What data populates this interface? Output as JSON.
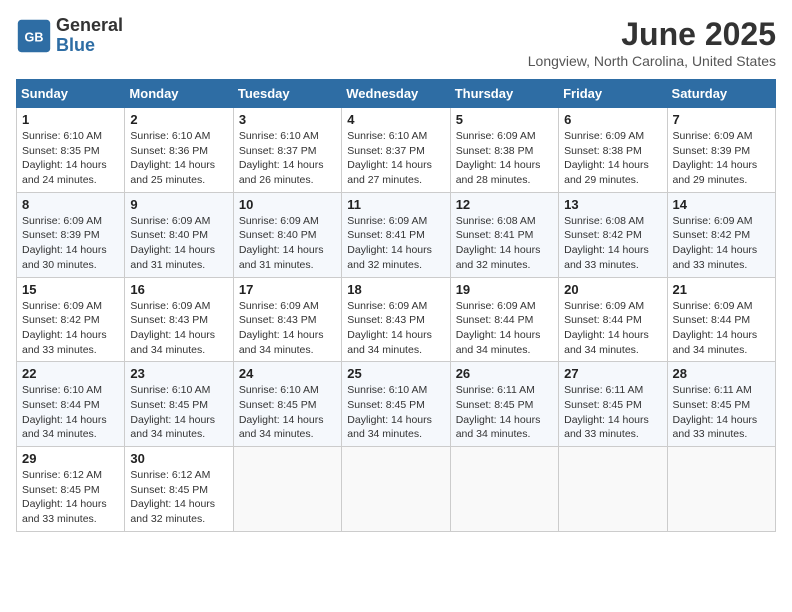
{
  "logo": {
    "general": "General",
    "blue": "Blue"
  },
  "title": "June 2025",
  "location": "Longview, North Carolina, United States",
  "weekdays": [
    "Sunday",
    "Monday",
    "Tuesday",
    "Wednesday",
    "Thursday",
    "Friday",
    "Saturday"
  ],
  "weeks": [
    [
      {
        "day": "1",
        "sunrise": "6:10 AM",
        "sunset": "8:35 PM",
        "daylight": "14 hours and 24 minutes."
      },
      {
        "day": "2",
        "sunrise": "6:10 AM",
        "sunset": "8:36 PM",
        "daylight": "14 hours and 25 minutes."
      },
      {
        "day": "3",
        "sunrise": "6:10 AM",
        "sunset": "8:37 PM",
        "daylight": "14 hours and 26 minutes."
      },
      {
        "day": "4",
        "sunrise": "6:10 AM",
        "sunset": "8:37 PM",
        "daylight": "14 hours and 27 minutes."
      },
      {
        "day": "5",
        "sunrise": "6:09 AM",
        "sunset": "8:38 PM",
        "daylight": "14 hours and 28 minutes."
      },
      {
        "day": "6",
        "sunrise": "6:09 AM",
        "sunset": "8:38 PM",
        "daylight": "14 hours and 29 minutes."
      },
      {
        "day": "7",
        "sunrise": "6:09 AM",
        "sunset": "8:39 PM",
        "daylight": "14 hours and 29 minutes."
      }
    ],
    [
      {
        "day": "8",
        "sunrise": "6:09 AM",
        "sunset": "8:39 PM",
        "daylight": "14 hours and 30 minutes."
      },
      {
        "day": "9",
        "sunrise": "6:09 AM",
        "sunset": "8:40 PM",
        "daylight": "14 hours and 31 minutes."
      },
      {
        "day": "10",
        "sunrise": "6:09 AM",
        "sunset": "8:40 PM",
        "daylight": "14 hours and 31 minutes."
      },
      {
        "day": "11",
        "sunrise": "6:09 AM",
        "sunset": "8:41 PM",
        "daylight": "14 hours and 32 minutes."
      },
      {
        "day": "12",
        "sunrise": "6:08 AM",
        "sunset": "8:41 PM",
        "daylight": "14 hours and 32 minutes."
      },
      {
        "day": "13",
        "sunrise": "6:08 AM",
        "sunset": "8:42 PM",
        "daylight": "14 hours and 33 minutes."
      },
      {
        "day": "14",
        "sunrise": "6:09 AM",
        "sunset": "8:42 PM",
        "daylight": "14 hours and 33 minutes."
      }
    ],
    [
      {
        "day": "15",
        "sunrise": "6:09 AM",
        "sunset": "8:42 PM",
        "daylight": "14 hours and 33 minutes."
      },
      {
        "day": "16",
        "sunrise": "6:09 AM",
        "sunset": "8:43 PM",
        "daylight": "14 hours and 34 minutes."
      },
      {
        "day": "17",
        "sunrise": "6:09 AM",
        "sunset": "8:43 PM",
        "daylight": "14 hours and 34 minutes."
      },
      {
        "day": "18",
        "sunrise": "6:09 AM",
        "sunset": "8:43 PM",
        "daylight": "14 hours and 34 minutes."
      },
      {
        "day": "19",
        "sunrise": "6:09 AM",
        "sunset": "8:44 PM",
        "daylight": "14 hours and 34 minutes."
      },
      {
        "day": "20",
        "sunrise": "6:09 AM",
        "sunset": "8:44 PM",
        "daylight": "14 hours and 34 minutes."
      },
      {
        "day": "21",
        "sunrise": "6:09 AM",
        "sunset": "8:44 PM",
        "daylight": "14 hours and 34 minutes."
      }
    ],
    [
      {
        "day": "22",
        "sunrise": "6:10 AM",
        "sunset": "8:44 PM",
        "daylight": "14 hours and 34 minutes."
      },
      {
        "day": "23",
        "sunrise": "6:10 AM",
        "sunset": "8:45 PM",
        "daylight": "14 hours and 34 minutes."
      },
      {
        "day": "24",
        "sunrise": "6:10 AM",
        "sunset": "8:45 PM",
        "daylight": "14 hours and 34 minutes."
      },
      {
        "day": "25",
        "sunrise": "6:10 AM",
        "sunset": "8:45 PM",
        "daylight": "14 hours and 34 minutes."
      },
      {
        "day": "26",
        "sunrise": "6:11 AM",
        "sunset": "8:45 PM",
        "daylight": "14 hours and 34 minutes."
      },
      {
        "day": "27",
        "sunrise": "6:11 AM",
        "sunset": "8:45 PM",
        "daylight": "14 hours and 33 minutes."
      },
      {
        "day": "28",
        "sunrise": "6:11 AM",
        "sunset": "8:45 PM",
        "daylight": "14 hours and 33 minutes."
      }
    ],
    [
      {
        "day": "29",
        "sunrise": "6:12 AM",
        "sunset": "8:45 PM",
        "daylight": "14 hours and 33 minutes."
      },
      {
        "day": "30",
        "sunrise": "6:12 AM",
        "sunset": "8:45 PM",
        "daylight": "14 hours and 32 minutes."
      },
      null,
      null,
      null,
      null,
      null
    ]
  ],
  "labels": {
    "sunrise": "Sunrise:",
    "sunset": "Sunset:",
    "daylight": "Daylight:"
  }
}
